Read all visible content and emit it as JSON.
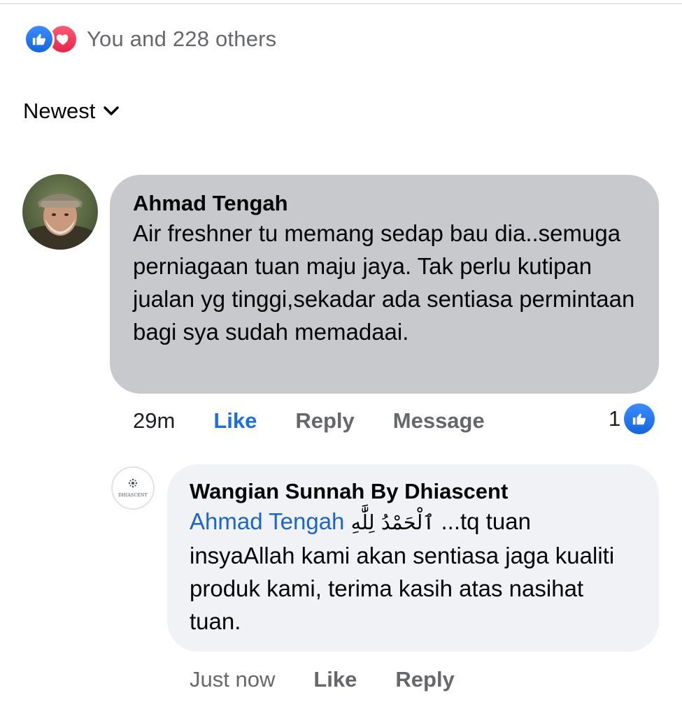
{
  "reactions": {
    "summary": "You and 228 others",
    "icons": [
      "like-icon",
      "love-icon"
    ],
    "like_color": "#1877f2",
    "love_color": "#f33e58"
  },
  "sort": {
    "label": "Newest",
    "icon": "chevron-down-icon"
  },
  "comments": [
    {
      "author": "Ahmad Tengah",
      "text": "Air freshner tu memang sedap bau dia..semuga perniagaan tuan maju jaya. Tak perlu kutipan jualan yg tinggi,sekadar ada sentiasa permintaan bagi sya sudah memadaai.",
      "time": "29m",
      "like_label": "Like",
      "reply_label": "Reply",
      "message_label": "Message",
      "like_count": "1",
      "liked": true
    },
    {
      "author": "Wangian Sunnah By Dhiascent",
      "mention": "Ahmad Tengah",
      "arabic": "ٱلْحَمْدُ لِلَّٰهِ",
      "text_tail": "...tq tuan insyaAllah kami akan sentiasa jaga kualiti produk kami, terima kasih atas nasihat tuan.",
      "time": "Just now",
      "like_label": "Like",
      "reply_label": "Reply",
      "avatar_logo_text": "DHIASCENT"
    }
  ],
  "colors": {
    "link_blue": "#1b6fe0",
    "mention_blue": "#1b66c9",
    "bubble_grey": "#c8c9cd",
    "bubble_light": "#f0f2f5"
  }
}
